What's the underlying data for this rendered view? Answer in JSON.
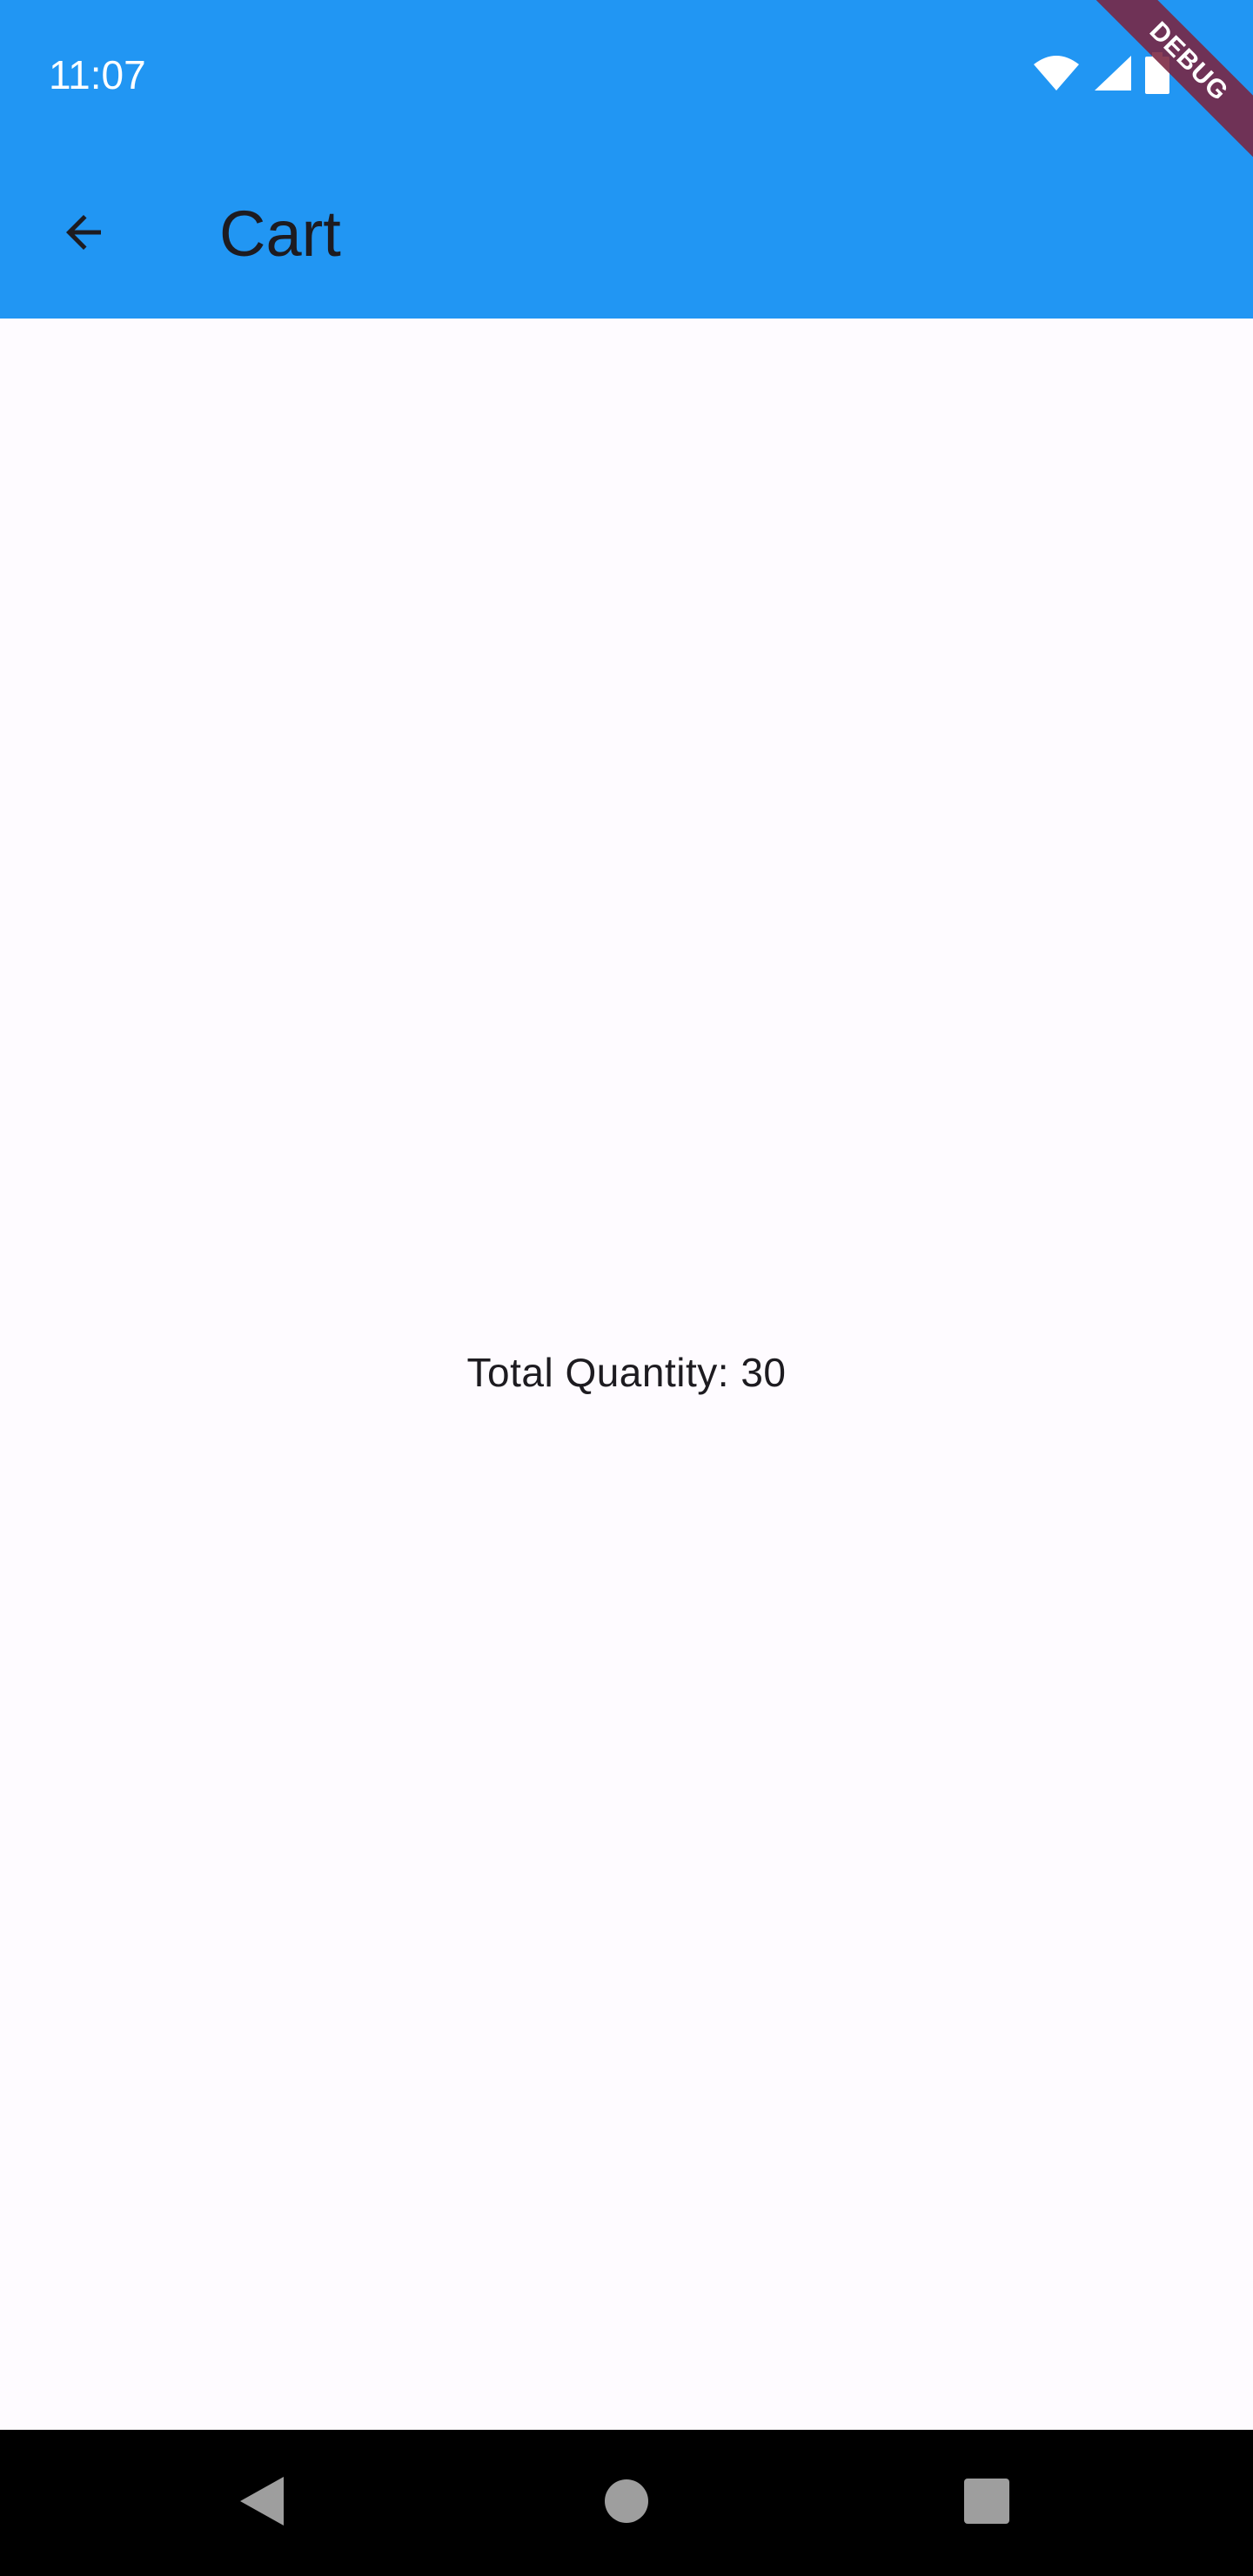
{
  "status_bar": {
    "time": "11:07",
    "icons": [
      "wifi-icon",
      "cell-signal-icon",
      "battery-icon"
    ]
  },
  "app_bar": {
    "title": "Cart",
    "back_icon": "arrow-back-icon"
  },
  "content": {
    "total_quantity_text": "Total Quantity: 30"
  },
  "debug_banner": {
    "label": "DEBUG"
  },
  "nav_bar": {
    "icons": [
      "back-triangle-icon",
      "home-circle-icon",
      "recents-square-icon"
    ]
  },
  "colors": {
    "app_bar": "#2196f3",
    "background": "#fefbff",
    "text": "#1d1b20",
    "debug_banner": "#7a2440",
    "nav_bar": "#000000"
  }
}
